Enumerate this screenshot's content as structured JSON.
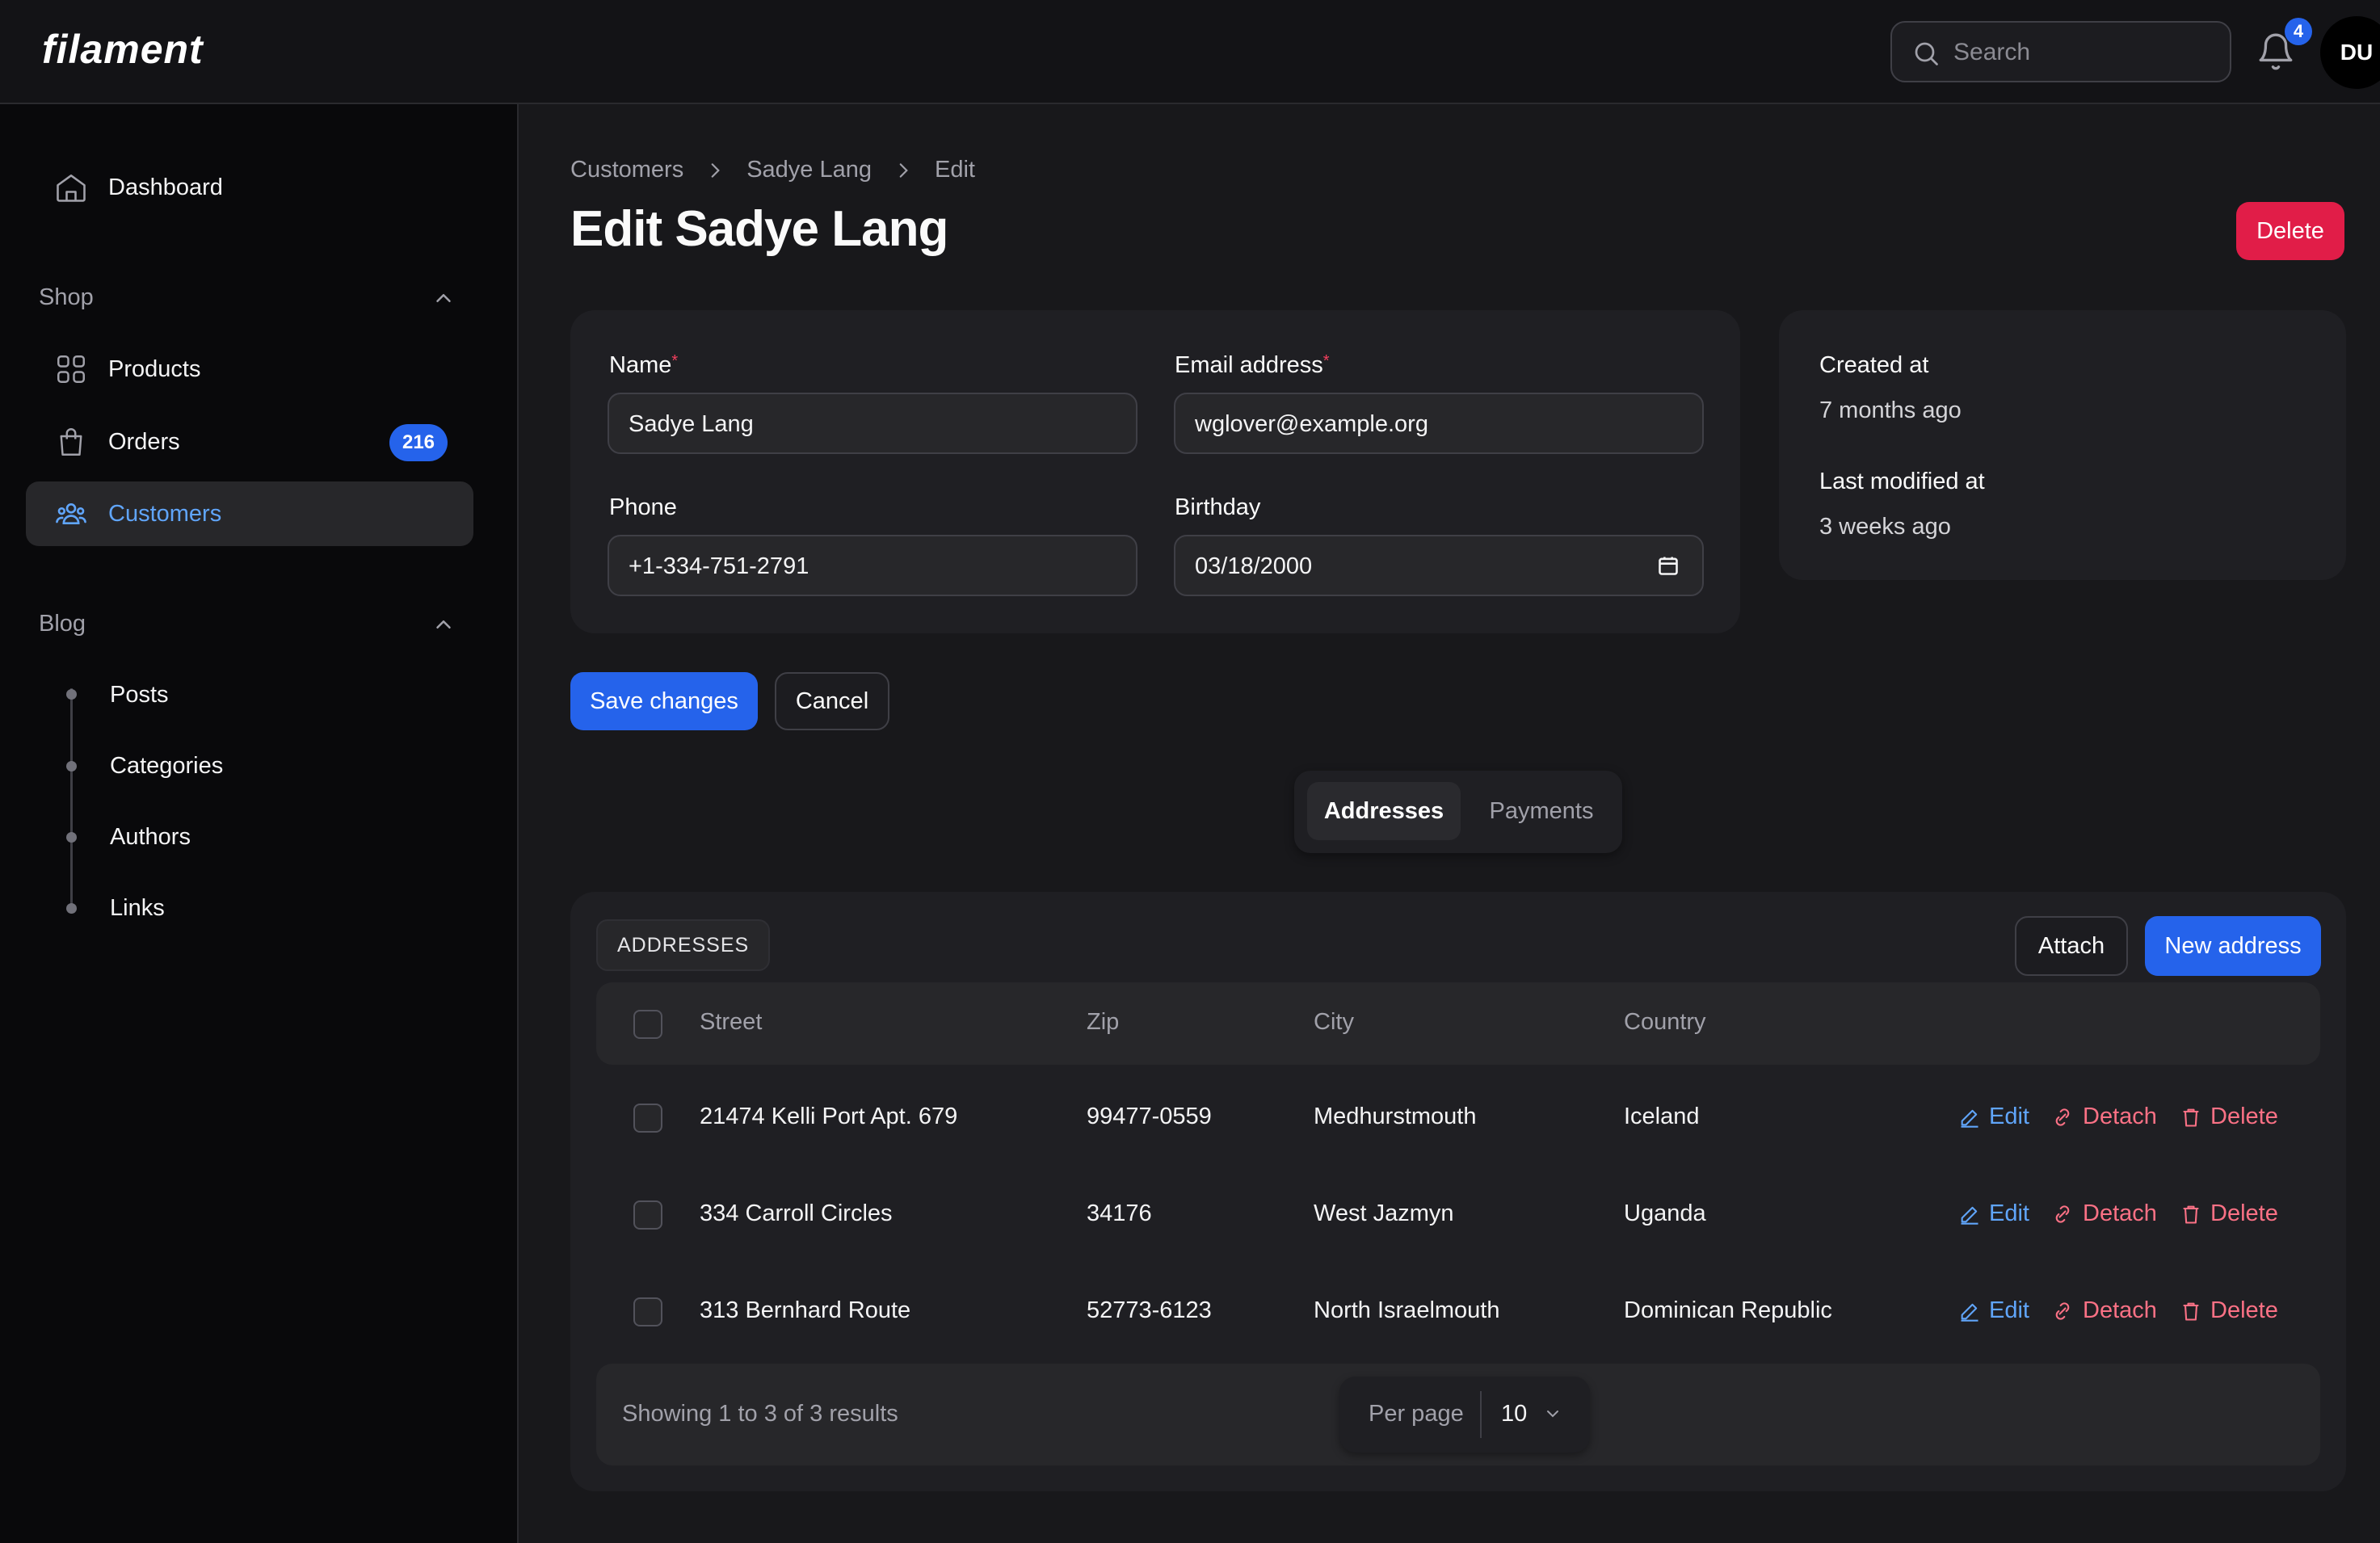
{
  "header": {
    "logo": "filament",
    "search_placeholder": "Search",
    "notification_count": "4",
    "avatar_initials": "DU"
  },
  "sidebar": {
    "dashboard": "Dashboard",
    "shop_label": "Shop",
    "products": "Products",
    "orders": "Orders",
    "orders_badge": "216",
    "customers": "Customers",
    "blog_label": "Blog",
    "posts": "Posts",
    "categories": "Categories",
    "authors": "Authors",
    "links": "Links"
  },
  "breadcrumb": {
    "items": [
      "Customers",
      "Sadye Lang",
      "Edit"
    ]
  },
  "page": {
    "title": "Edit Sadye Lang",
    "delete_label": "Delete"
  },
  "form": {
    "name_label": "Name",
    "name_value": "Sadye Lang",
    "email_label": "Email address",
    "email_value": "wglover@example.org",
    "phone_label": "Phone",
    "phone_value": "+1-334-751-2791",
    "birthday_label": "Birthday",
    "birthday_value": "03/18/2000",
    "required_mark": "*"
  },
  "meta": {
    "created_label": "Created at",
    "created_value": "7 months ago",
    "modified_label": "Last modified at",
    "modified_value": "3 weeks ago"
  },
  "actions": {
    "save": "Save changes",
    "cancel": "Cancel"
  },
  "tabs": {
    "addresses": "Addresses",
    "payments": "Payments"
  },
  "addresses": {
    "heading": "ADDRESSES",
    "attach": "Attach",
    "new": "New address",
    "columns": [
      "Street",
      "Zip",
      "City",
      "Country"
    ],
    "rows": [
      {
        "street": "21474 Kelli Port Apt. 679",
        "zip": "99477-0559",
        "city": "Medhurstmouth",
        "country": "Iceland"
      },
      {
        "street": "334 Carroll Circles",
        "zip": "34176",
        "city": "West Jazmyn",
        "country": "Uganda"
      },
      {
        "street": "313 Bernhard Route",
        "zip": "52773-6123",
        "city": "North Israelmouth",
        "country": "Dominican Republic"
      }
    ],
    "row_actions": {
      "edit": "Edit",
      "detach": "Detach",
      "delete": "Delete"
    },
    "footer": "Showing 1 to 3 of 3 results",
    "per_page_label": "Per page",
    "per_page_value": "10"
  },
  "colors": {
    "accent": "#2563eb",
    "danger": "#e11d48",
    "active_nav": "#60a5fa"
  }
}
